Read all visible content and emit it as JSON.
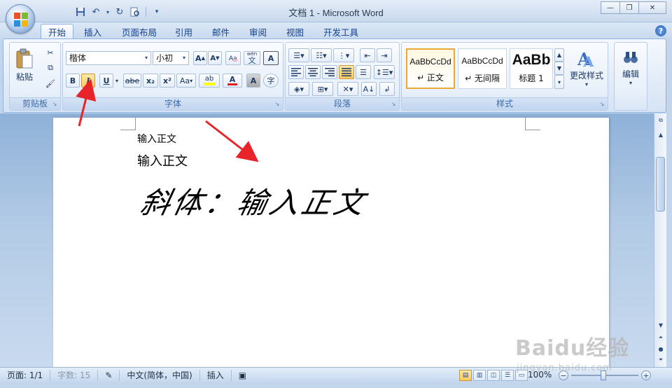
{
  "window": {
    "title": "文档 1 - Microsoft Word",
    "controls": [
      "—",
      "❐",
      "✕"
    ]
  },
  "quick_access": [
    "save-icon",
    "undo-icon",
    "redo-icon",
    "print-preview-icon"
  ],
  "tabs": [
    {
      "label": "开始",
      "active": true
    },
    {
      "label": "插入"
    },
    {
      "label": "页面布局"
    },
    {
      "label": "引用"
    },
    {
      "label": "邮件"
    },
    {
      "label": "审阅"
    },
    {
      "label": "视图"
    },
    {
      "label": "开发工具"
    }
  ],
  "ribbon": {
    "clipboard": {
      "label": "剪贴板",
      "paste_label": "粘贴"
    },
    "font": {
      "label": "字体",
      "font_name": "楷体",
      "font_size": "小初",
      "bold": "B",
      "italic": "I",
      "underline": "U",
      "strikethrough": "abe",
      "subscript": "x₂",
      "superscript": "x²",
      "change_case": "Aa",
      "highlight": "ab",
      "font_color": "A",
      "char_shading": "A",
      "phonetic": "wén",
      "enclose": "字"
    },
    "paragraph": {
      "label": "段落"
    },
    "styles": {
      "label": "样式",
      "items": [
        {
          "preview": "AaBbCcDd",
          "name": "↵ 正文",
          "selected": true
        },
        {
          "preview": "AaBbCcDd",
          "name": "↵ 无间隔"
        },
        {
          "preview": "AaBb",
          "name": "标题 1"
        }
      ],
      "change_styles_label": "更改样式"
    },
    "editing": {
      "label": "编辑"
    }
  },
  "document": {
    "line1": "输入正文",
    "line2": "输入正文",
    "line3": "斜体：输入正文"
  },
  "status": {
    "page": "页面: 1/1",
    "words": "字数: 15",
    "language": "中文(简体，中国)",
    "mode": "插入",
    "zoom": "100%"
  },
  "watermark": {
    "main": "Baidu经验",
    "sub": "jingyan.baidu.com"
  },
  "colors": {
    "accent": "#15428b",
    "annotation": "#e8242b",
    "active_button": "#ffc95c"
  }
}
